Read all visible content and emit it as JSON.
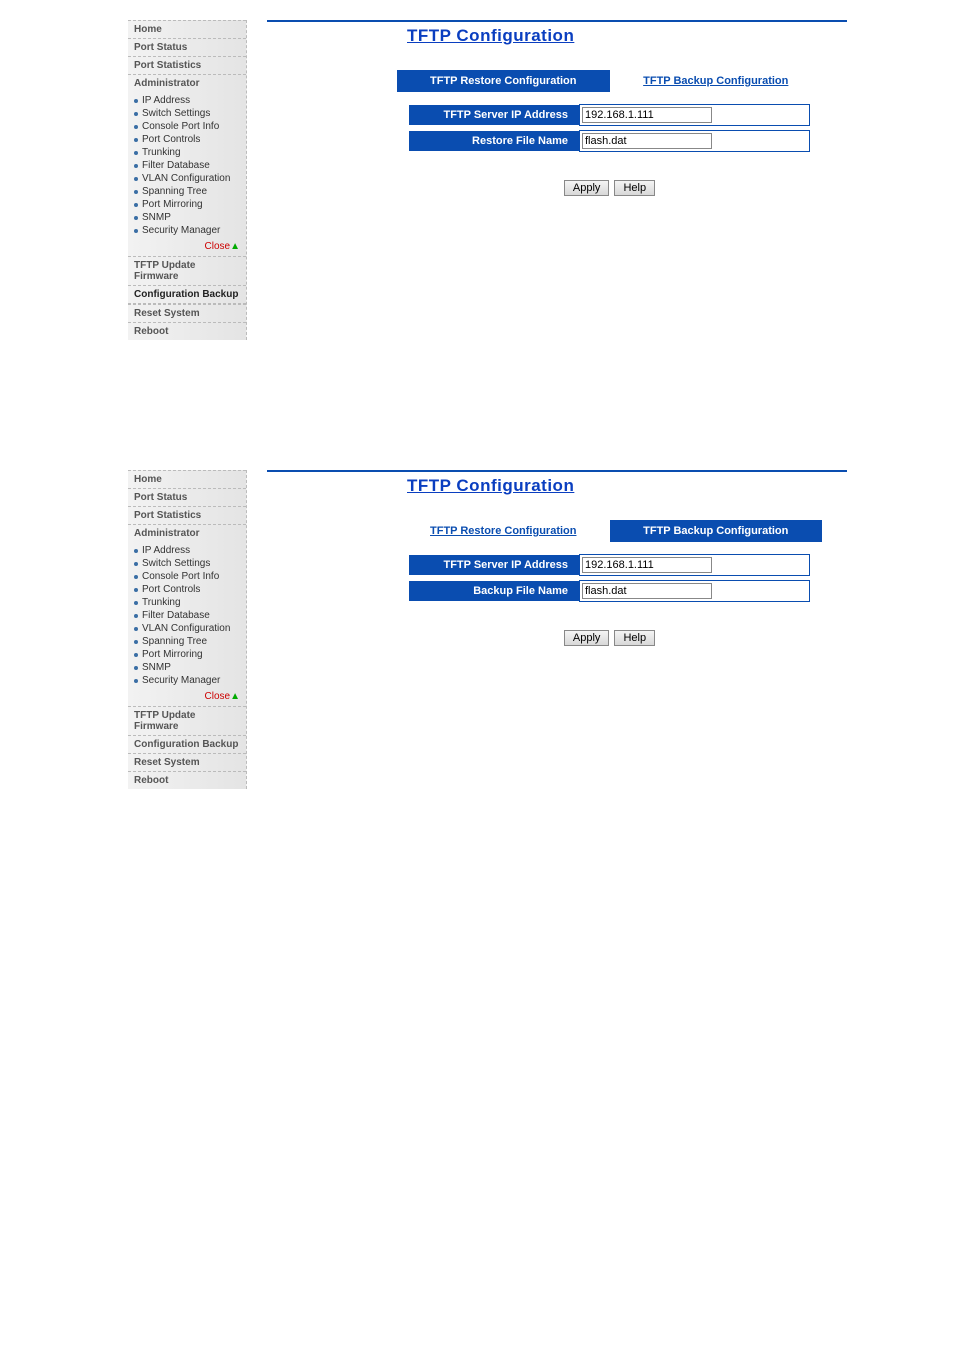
{
  "sidebar": {
    "home": "Home",
    "port_status": "Port Status",
    "port_statistics": "Port Statistics",
    "administrator": "Administrator",
    "items": [
      {
        "label": "IP Address"
      },
      {
        "label": "Switch Settings"
      },
      {
        "label": "Console Port Info"
      },
      {
        "label": "Port Controls"
      },
      {
        "label": "Trunking"
      },
      {
        "label": "Filter Database"
      },
      {
        "label": "VLAN Configuration"
      },
      {
        "label": "Spanning Tree"
      },
      {
        "label": "Port Mirroring"
      },
      {
        "label": "SNMP"
      },
      {
        "label": "Security Manager"
      }
    ],
    "close": "Close",
    "tftp_update": "TFTP Update Firmware",
    "config_backup": "Configuration Backup",
    "reset_system": "Reset System",
    "reboot": "Reboot"
  },
  "screens": [
    {
      "title": "TFTP Configuration",
      "tabs": [
        {
          "label": "TFTP Restore Configuration",
          "active": true
        },
        {
          "label": "TFTP Backup Configuration",
          "active": false
        }
      ],
      "fields": [
        {
          "label": "TFTP Server IP Address",
          "value": "192.168.1.111"
        },
        {
          "label": "Restore File Name",
          "value": "flash.dat"
        }
      ],
      "buttons": {
        "apply": "Apply",
        "help": "Help"
      }
    },
    {
      "title": "TFTP Configuration",
      "tabs": [
        {
          "label": "TFTP Restore Configuration",
          "active": false
        },
        {
          "label": "TFTP Backup Configuration",
          "active": true
        }
      ],
      "fields": [
        {
          "label": "TFTP Server IP Address",
          "value": "192.168.1.111"
        },
        {
          "label": "Backup File Name",
          "value": "flash.dat"
        }
      ],
      "buttons": {
        "apply": "Apply",
        "help": "Help"
      }
    }
  ]
}
